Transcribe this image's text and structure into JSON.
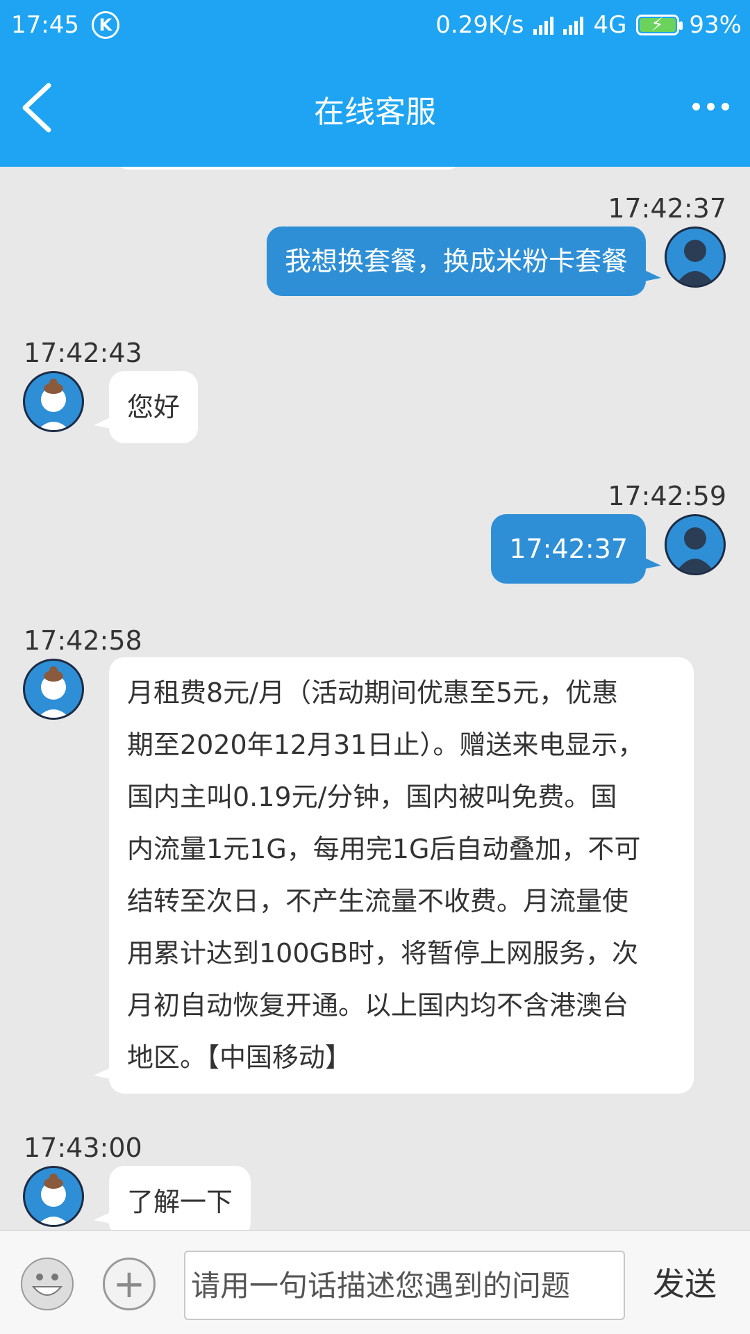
{
  "status": {
    "time": "17:45",
    "k_badge": "K",
    "net_speed": "0.29K/s",
    "network": "4G",
    "battery": "93%"
  },
  "header": {
    "title": "在线客服"
  },
  "colors": {
    "accent": "#1ea4f2",
    "outgoing_bubble": "#2f8fd6",
    "incoming_bubble": "#ffffff",
    "background": "#e8e8e8"
  },
  "messages": [
    {
      "time": "17:42:37",
      "text": "我想换套餐，换成米粉卡套餐"
    },
    {
      "time": "17:42:43",
      "text": "您好"
    },
    {
      "time": "17:42:59",
      "text": "17:42:37"
    },
    {
      "time": "17:42:58",
      "lines": [
        "月租费8元/月（活动期间优惠至5元，优惠",
        "期至2020年12月31日止）。赠送来电显示，",
        "国内主叫0.19元/分钟，国内被叫免费。国",
        "内流量1元1G，每用完1G后自动叠加，不可",
        "结转至次日，不产生流量不收费。月流量使",
        "用累计达到100GB时，将暂停上网服务，次",
        "月初自动恢复开通。以上国内均不含港澳台",
        "地区。【中国移动】"
      ]
    },
    {
      "time": "17:43:00",
      "text": "了解一下"
    }
  ],
  "input": {
    "placeholder": "请用一句话描述您遇到的问题",
    "send_label": "发送",
    "plus_label": "+"
  },
  "icons": {
    "back": "chevron-left-icon",
    "more": "more-dots-icon",
    "emoji": "smiley-icon",
    "plus": "plus-icon"
  }
}
